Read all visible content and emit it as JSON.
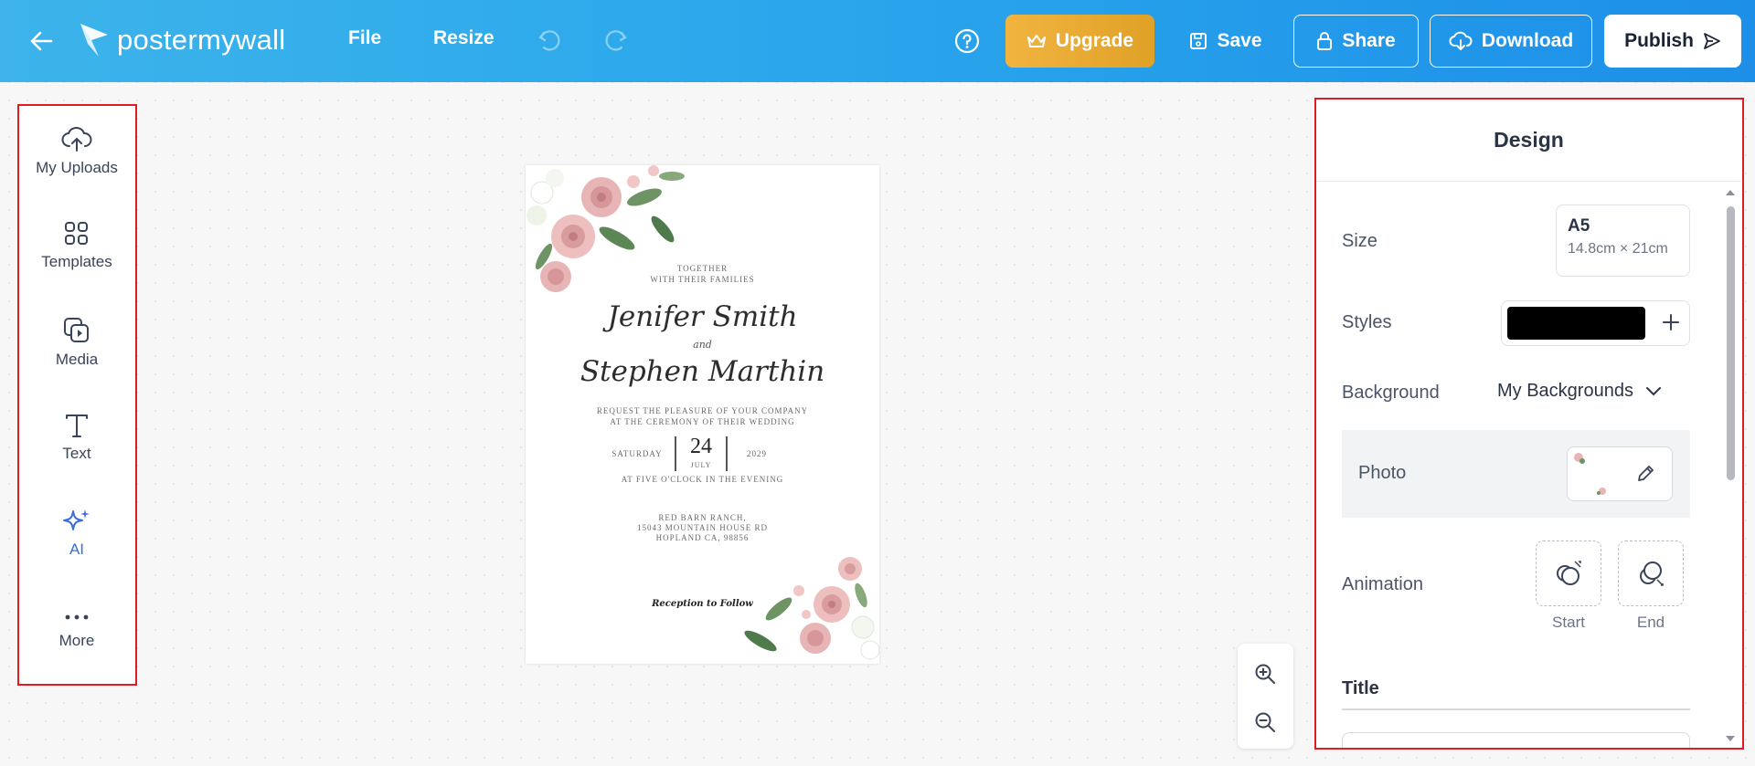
{
  "topbar": {
    "logo_text": "postermywall",
    "menu": [
      "File",
      "Resize"
    ],
    "upgrade_label": "Upgrade",
    "save_label": "Save",
    "share_label": "Share",
    "download_label": "Download",
    "publish_label": "Publish",
    "brand_color": "#2aa7ec",
    "upgrade_color": "#e9ab33"
  },
  "sidebar": {
    "items": [
      {
        "label": "My Uploads",
        "icon": "cloud-upload-icon"
      },
      {
        "label": "Templates",
        "icon": "templates-grid-icon"
      },
      {
        "label": "Media",
        "icon": "media-icon"
      },
      {
        "label": "Text",
        "icon": "text-icon"
      },
      {
        "label": "AI",
        "icon": "ai-sparkle-icon"
      },
      {
        "label": "More",
        "icon": "more-dots-icon"
      }
    ]
  },
  "poster": {
    "together_line1": "TOGETHER",
    "together_line2": "WITH THEIR FAMILIES",
    "name1": "Jenifer Smith",
    "and": "and",
    "name2": "Stephen Marthin",
    "request_line1": "REQUEST THE PLEASURE OF YOUR COMPANY",
    "request_line2": "AT THE CEREMONY OF THEIR WEDDING",
    "day": "SATURDAY",
    "date": "24",
    "month": "JULY",
    "year": "2029",
    "time": "AT FIVE O'CLOCK IN THE EVENING",
    "venue_line1": "RED BARN RANCH,",
    "venue_line2": "15043 MOUNTAIN HOUSE RD",
    "venue_line3": "HOPLAND CA, 98856",
    "reception": "Reception to Follow"
  },
  "design_panel": {
    "title": "Design",
    "size_label": "Size",
    "size_name": "A5",
    "size_dims": "14.8cm × 21cm",
    "styles_label": "Styles",
    "style_color": "#000000",
    "background_label": "Background",
    "background_value": "My Backgrounds",
    "photo_label": "Photo",
    "animation_label": "Animation",
    "anim_start": "Start",
    "anim_end": "End",
    "title_label": "Title"
  }
}
